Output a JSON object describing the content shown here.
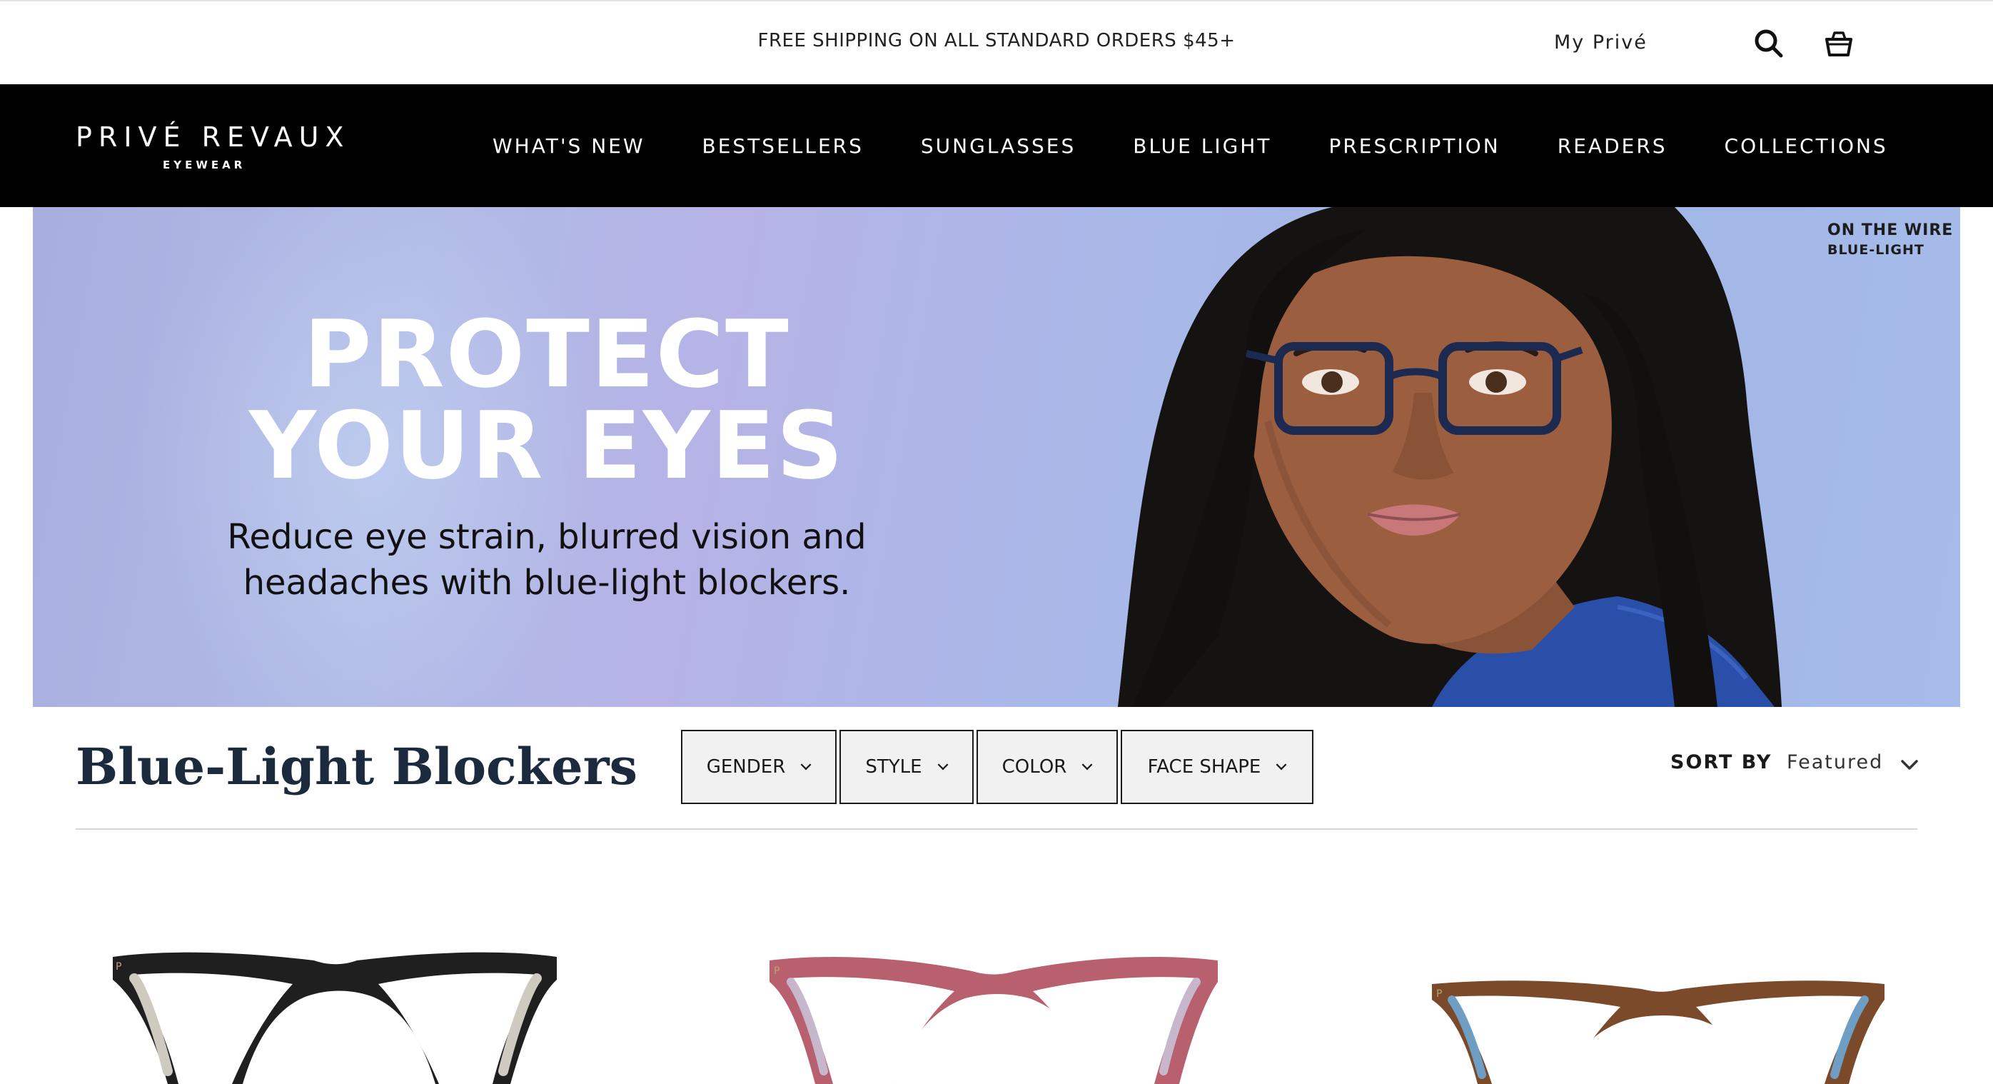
{
  "announcement": {
    "text": "FREE SHIPPING ON ALL STANDARD ORDERS $45+",
    "account_label": "My Privé"
  },
  "icons": {
    "search": "search-icon",
    "cart": "shopping-bag-icon"
  },
  "logo": {
    "brand": "PRIVÉ REVAUX",
    "subtitle": "EYEWEAR"
  },
  "nav": {
    "items": [
      {
        "label": "WHAT'S NEW"
      },
      {
        "label": "BESTSELLERS"
      },
      {
        "label": "SUNGLASSES"
      },
      {
        "label": "BLUE LIGHT"
      },
      {
        "label": "PRESCRIPTION"
      },
      {
        "label": "READERS"
      },
      {
        "label": "COLLECTIONS"
      }
    ]
  },
  "hero": {
    "headline_line1": "PROTECT",
    "headline_line2": "YOUR EYES",
    "subtext_line1": "Reduce eye strain, blurred vision and",
    "subtext_line2": "headaches with blue-light blockers.",
    "tag_title": "ON THE WIRE",
    "tag_subtitle": "BLUE-LIGHT"
  },
  "collection": {
    "title": "Blue-Light Blockers",
    "filters": [
      {
        "label": "GENDER"
      },
      {
        "label": "STYLE"
      },
      {
        "label": "COLOR"
      },
      {
        "label": "FACE SHAPE"
      }
    ],
    "sort_label": "SORT BY",
    "sort_value": "Featured"
  },
  "products": [
    {
      "frame_color": "#1f1f1f",
      "temple_color": "#cfcac0"
    },
    {
      "frame_color": "#b9606f",
      "temple_color": "#c7b7cc"
    },
    {
      "frame_color": "#7a4a2a",
      "temple_color": "#6f9ec5"
    }
  ]
}
